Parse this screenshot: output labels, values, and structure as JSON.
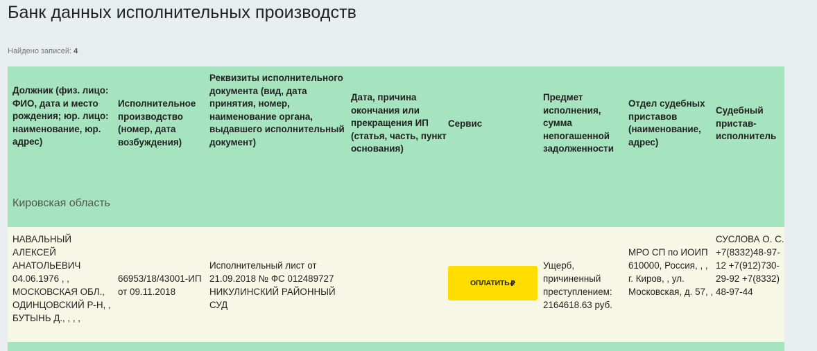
{
  "page": {
    "title": "Банк данных исполнительных производств",
    "found_label": "Найдено записей:",
    "found_count": "4"
  },
  "table": {
    "headers": [
      "Должник (физ. лицо: ФИО, дата и место рождения; юр. лицо: наименование, юр. адрес)",
      "Исполнительное производство (номер, дата возбуждения)",
      "Реквизиты исполнительного документа (вид, дата принятия, номер, наименование органа, выдавшего исполнительный документ)",
      "Дата, причина окончания или прекращения ИП (статья, часть, пункт основания)",
      "Сервис",
      "Предмет исполнения, сумма непогашенной задолженности",
      "Отдел судебных приставов (наименование, адрес)",
      "Судебный пристав-исполнитель"
    ],
    "region": "Кировская область",
    "row": {
      "debtor": "НАВАЛЬНЫЙ АЛЕКСЕЙ АНАТОЛЬЕВИЧ 04.06.1976 , , МОСКОВСКАЯ ОБЛ., ОДИНЦОВСКИЙ Р-Н, , БУТЫНЬ Д., , , ,",
      "proceeding": "66953/18/43001-ИП от 09.11.2018",
      "document": "Исполнительный лист от 21.09.2018 № ФС 012489727 НИКУЛИНСКИЙ РАЙОННЫЙ СУД",
      "end_date": "",
      "pay_label": "ОПЛАТИТЬ",
      "subject": "Ущерб, причиненный преступлением: 2164618.63 руб.",
      "department": "МРО СП по ИОИП 610000, Россия, , , г. Киров, , ул. Московская, д. 57, ,",
      "bailiff": "СУСЛОВА О. С. +7(8332)48-97-12 +7(912)730-29-92 +7(8332)48-97-44"
    }
  },
  "colors": {
    "header_bg": "#a6e3bf",
    "row_bg": "#f7f7e6",
    "button_bg": "#ffdd00",
    "page_bg": "#e8edf0"
  }
}
